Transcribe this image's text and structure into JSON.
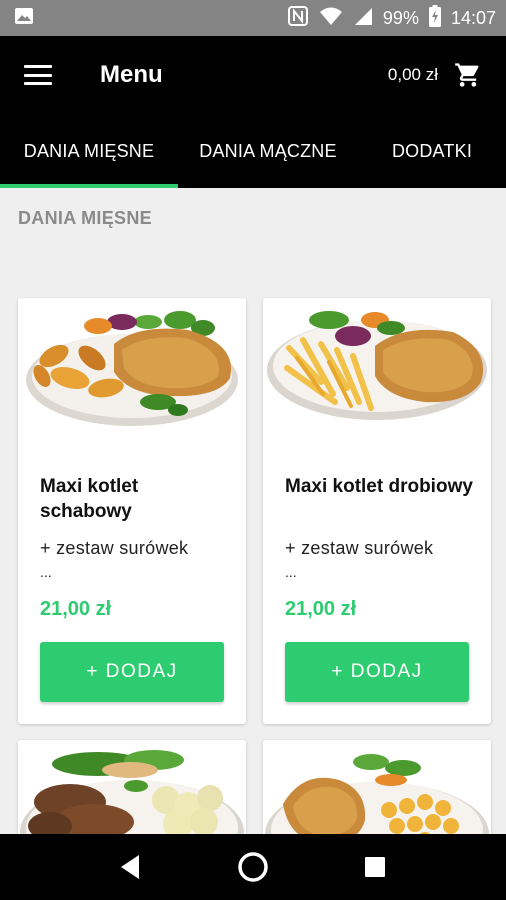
{
  "status_bar": {
    "battery": "99%",
    "time": "14:07",
    "icons": [
      "image-icon",
      "nfc-icon",
      "wifi-icon",
      "signal-icon",
      "battery-icon"
    ]
  },
  "app_bar": {
    "title": "Menu",
    "cart_total": "0,00 zł",
    "icons": [
      "menu-icon",
      "cart-icon"
    ]
  },
  "tabs": [
    {
      "label": "DANIA MIĘSNE",
      "active": true
    },
    {
      "label": "DANIA MĄCZNE",
      "active": false
    },
    {
      "label": "DODATKI",
      "active": false
    }
  ],
  "section": {
    "title": "DANIA MIĘSNE"
  },
  "products": [
    {
      "name": "Maxi kotlet schabowy",
      "description": "+ zestaw surówek",
      "more": "...",
      "price": "21,00 zł",
      "button": "+ DODAJ"
    },
    {
      "name": "Maxi kotlet drobiowy",
      "description": "+ zestaw surówek",
      "more": "...",
      "price": "21,00 zł",
      "button": "+ DODAJ"
    },
    {
      "name": "",
      "description": "",
      "more": "",
      "price": "",
      "button": ""
    },
    {
      "name": "",
      "description": "",
      "more": "",
      "price": "",
      "button": ""
    }
  ],
  "colors": {
    "accent": "#2ecc71",
    "app_bar": "#000000",
    "status_bar": "#848484",
    "background": "#efefef"
  },
  "nav_bar": {
    "icons": [
      "back-icon",
      "home-icon",
      "recents-icon"
    ]
  }
}
